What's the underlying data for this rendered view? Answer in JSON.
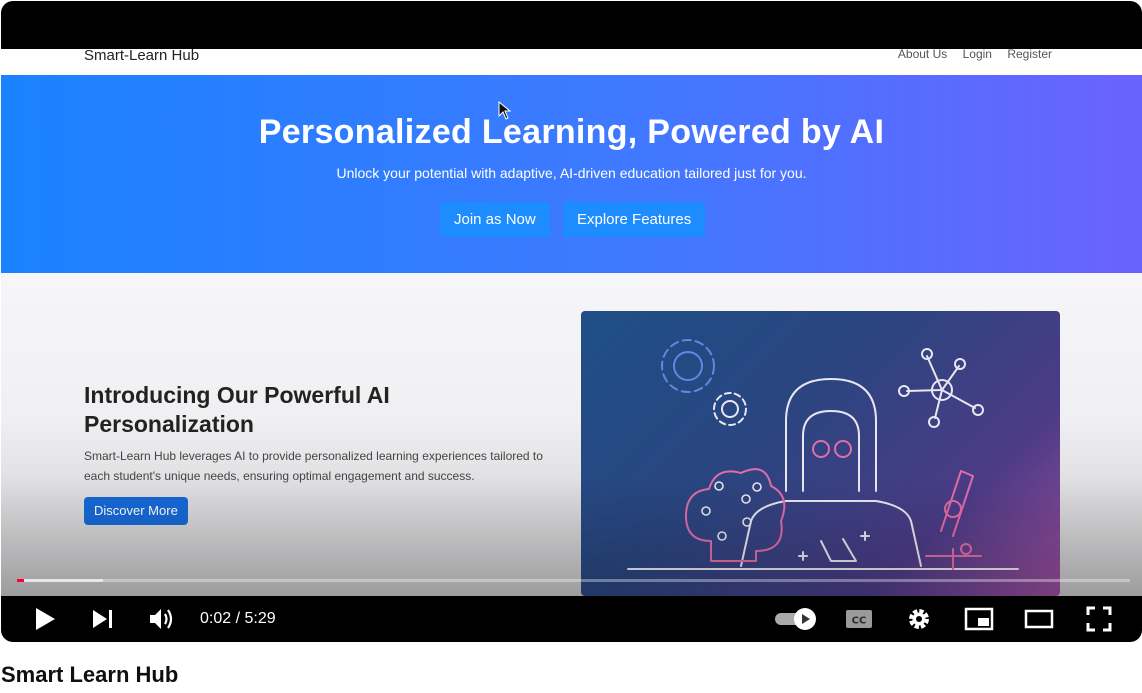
{
  "site": {
    "brand": "Smart-Learn Hub",
    "nav": [
      "About Us",
      "Login",
      "Register"
    ],
    "hero_title": "Personalized Learning, Powered by AI",
    "hero_subtitle": "Unlock your potential with adaptive, AI-driven education tailored just for you.",
    "hero_buttons": [
      "Join as Now",
      "Explore Features"
    ],
    "intro_title": "Introducing Our Powerful AI Personalization",
    "intro_text": "Smart-Learn Hub leverages AI to provide personalized learning experiences tailored to each student's unique needs, ensuring optimal engagement and success.",
    "intro_button": "Discover More"
  },
  "player": {
    "time": "0:02 / 5:29",
    "progress_played_fraction": 0.006,
    "progress_buffered_fraction": 0.077,
    "icons": [
      "play-icon",
      "next-icon",
      "volume-icon",
      "autoplay-toggle-icon",
      "captions-icon",
      "settings-icon",
      "miniplayer-icon",
      "theater-icon",
      "fullscreen-icon"
    ]
  },
  "video_title": "Smart Learn Hub"
}
